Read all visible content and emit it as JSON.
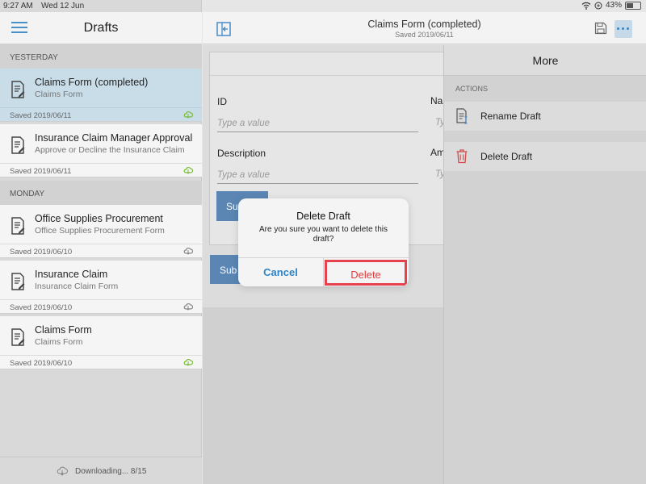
{
  "status_bar": {
    "time": "9:27 AM",
    "date": "Wed 12 Jun",
    "battery": "43%"
  },
  "sidebar": {
    "title": "Drafts",
    "sections": [
      {
        "label": "YESTERDAY"
      },
      {
        "label": "MONDAY"
      }
    ],
    "drafts": [
      {
        "name": "Claims Form (completed)",
        "form": "Claims Form",
        "saved": "Saved 2019/06/11",
        "sync": "synced"
      },
      {
        "name": "Insurance Claim Manager Approval",
        "form": "Approve or Decline the Insurance Claim",
        "saved": "Saved 2019/06/11",
        "sync": "synced"
      },
      {
        "name": "Office Supplies Procurement",
        "form": "Office Supplies Procurement Form",
        "saved": "Saved 2019/06/10",
        "sync": "not-synced"
      },
      {
        "name": "Insurance Claim",
        "form": "Insurance Claim Form",
        "saved": "Saved 2019/06/10",
        "sync": "not-synced"
      },
      {
        "name": "Claims Form",
        "form": "Claims Form",
        "saved": "Saved 2019/06/10",
        "sync": "synced"
      }
    ],
    "footer": "Downloading... 8/15"
  },
  "header": {
    "title": "Claims Form (completed)",
    "subtitle": "Saved 2019/06/11"
  },
  "form": {
    "fields": [
      {
        "label": "ID",
        "placeholder": "Type a value"
      },
      {
        "label": "Na",
        "placeholder": "Ty"
      },
      {
        "label": "Description",
        "placeholder": "Type a value"
      },
      {
        "label": "Am",
        "placeholder": "Ty"
      }
    ],
    "submit_label_inner": "Su",
    "submit_label_outer": "Sub"
  },
  "more_panel": {
    "title": "More",
    "section": "ACTIONS",
    "actions": [
      {
        "label": "Rename Draft"
      },
      {
        "label": "Delete Draft"
      }
    ]
  },
  "alert": {
    "title": "Delete Draft",
    "message": "Are you sure you want to delete this draft?",
    "cancel": "Cancel",
    "delete": "Delete"
  },
  "colors": {
    "accent": "#2e84c6",
    "danger": "#e23a3a",
    "sync_green": "#7bbd3c"
  }
}
